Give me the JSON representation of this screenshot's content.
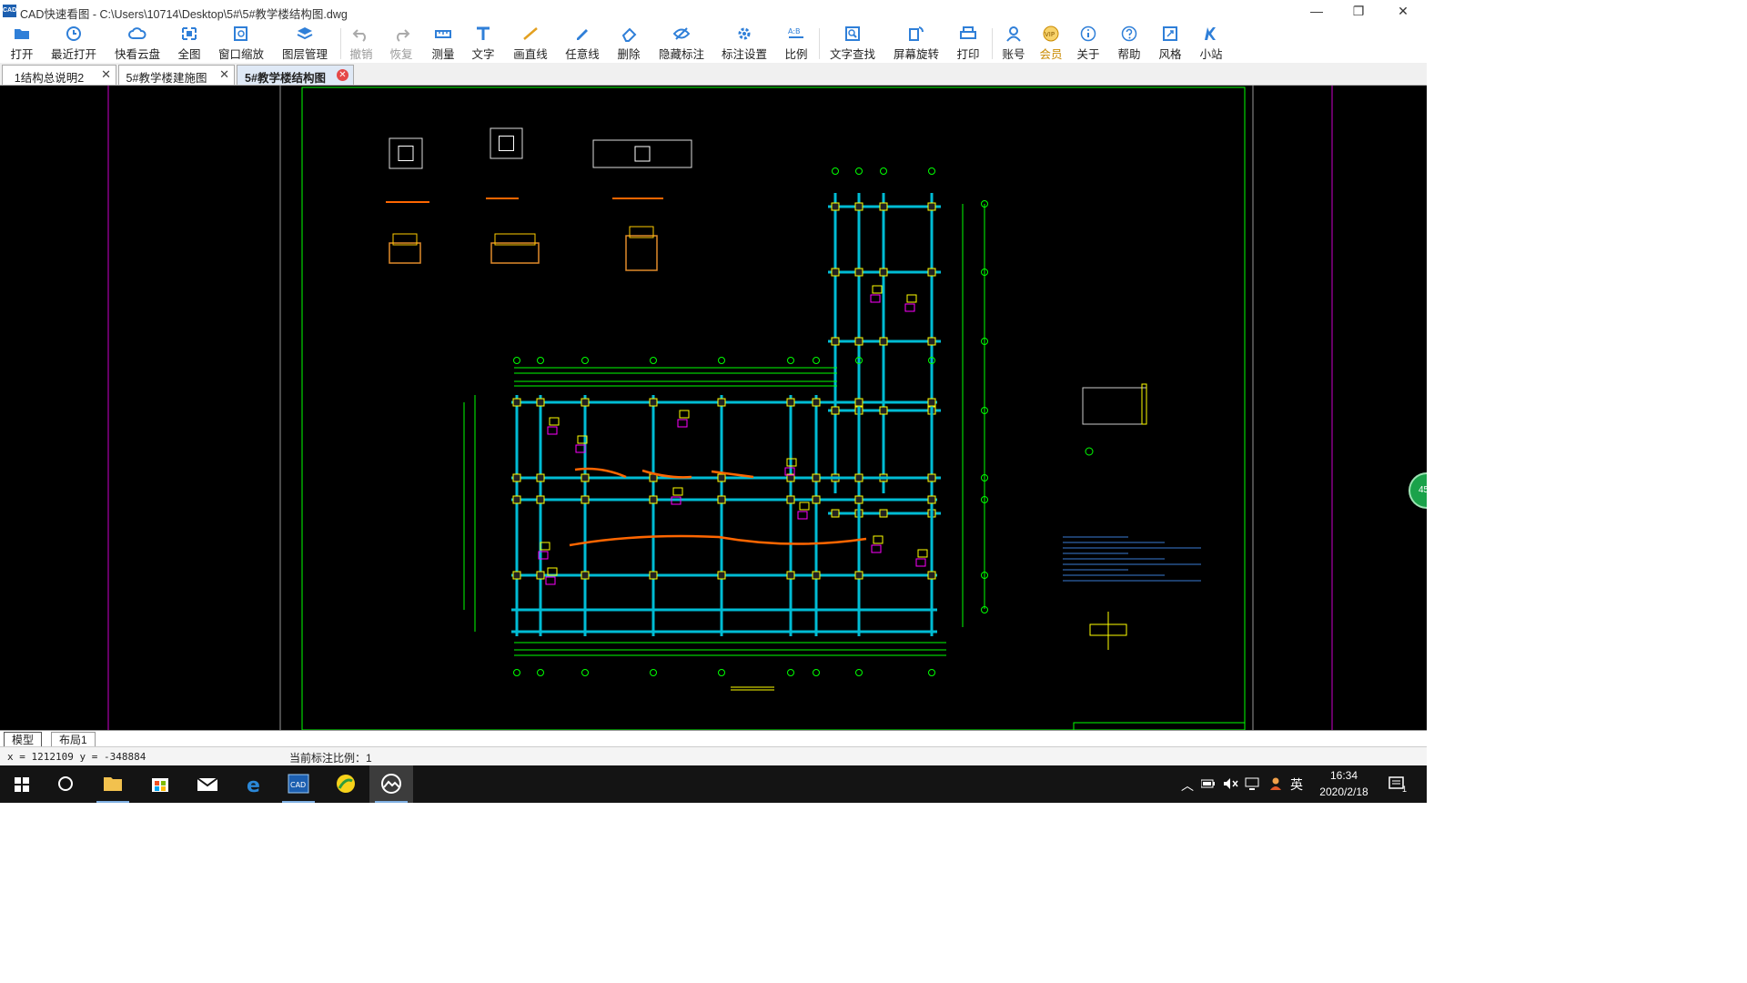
{
  "window": {
    "title": "CAD快速看图 - C:\\Users\\10714\\Desktop\\5#\\5#教学楼结构图.dwg",
    "logo_text": "CAD",
    "minimize": "—",
    "restore": "❐",
    "close": "✕"
  },
  "toolbar": {
    "open": "打开",
    "recent": "最近打开",
    "cloud": "快看云盘",
    "fit": "全图",
    "window_zoom": "窗口缩放",
    "layers": "图层管理",
    "undo": "撤销",
    "redo": "恢复",
    "measure": "测量",
    "text": "文字",
    "line": "画直线",
    "freeline": "任意线",
    "delete": "删除",
    "hide_dims": "隐藏标注",
    "dim_settings": "标注设置",
    "scale": "比例",
    "text_search": "文字查找",
    "rotate": "屏幕旋转",
    "print": "打印",
    "account": "账号",
    "vip": "会员",
    "about": "关于",
    "help": "帮助",
    "style": "风格",
    "site": "小站"
  },
  "tabs": [
    {
      "label": "1结构总说明2",
      "close": "✕"
    },
    {
      "label": "5#教学楼建施图",
      "close": "✕"
    },
    {
      "label": "5#教学楼结构图",
      "close": "✕"
    }
  ],
  "drawing": {
    "zoom_badge": "45",
    "colors": {
      "frame": "#00ff00",
      "beam": "#00bcd4",
      "column": "#ffff00",
      "dim": "#00ff00",
      "highlight": "#ff6600",
      "note": "#ff00ff"
    }
  },
  "layout_tabs": {
    "model": "模型",
    "layout1": "布局1"
  },
  "status": {
    "coords": "x = 1212109 y = -348884",
    "scale": "当前标注比例：1"
  },
  "taskbar": {
    "ime": "英",
    "time": "16:34",
    "date": "2020/2/18",
    "notif_count": "1"
  }
}
